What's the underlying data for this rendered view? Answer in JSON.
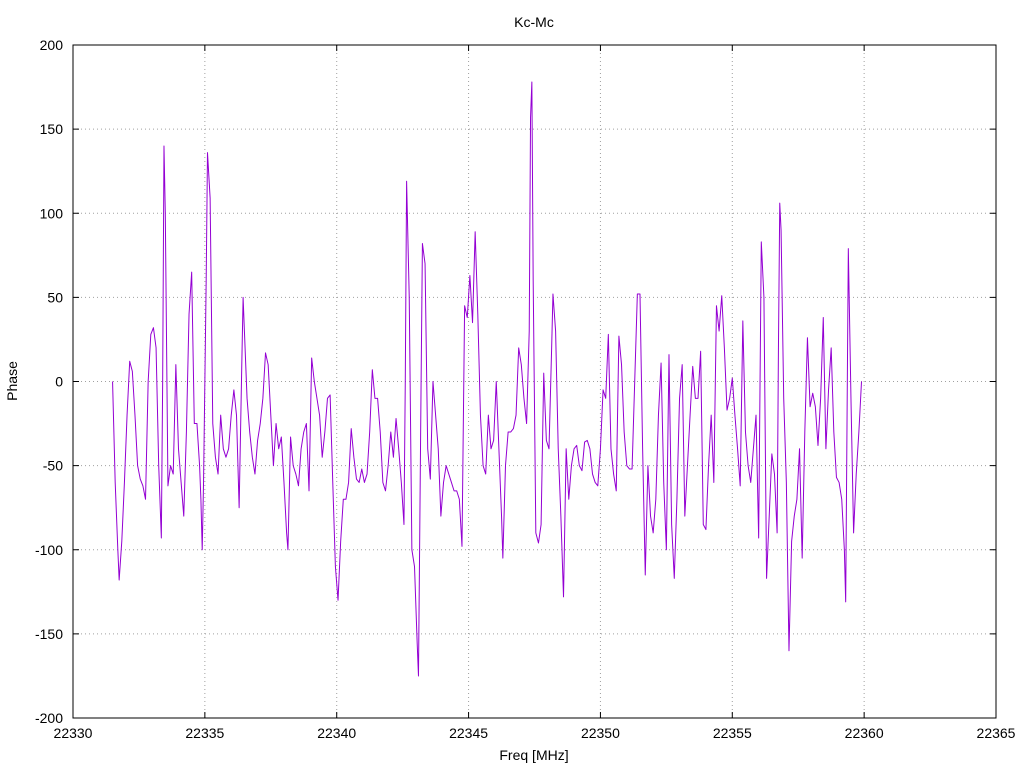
{
  "chart_data": {
    "type": "line",
    "title": "Kc-Mc",
    "xlabel": "Freq [MHz]",
    "ylabel": "Phase",
    "xlim": [
      22330,
      22365
    ],
    "ylim": [
      -200,
      200
    ],
    "x_ticks": [
      "22330",
      "22335",
      "22340",
      "22345",
      "22350",
      "22355",
      "22360",
      "22365"
    ],
    "y_ticks": [
      "200",
      "150",
      "100",
      "50",
      "0",
      "-50",
      "-100",
      "-150",
      "-200"
    ],
    "grid": true,
    "line_color": "#9400d3",
    "series": [
      {
        "values": [
          [
            22331.5,
            0
          ],
          [
            22331.6,
            -60
          ],
          [
            22331.7,
            -100
          ],
          [
            22331.75,
            -118
          ],
          [
            22331.85,
            -95
          ],
          [
            22331.95,
            -60
          ],
          [
            22332.05,
            -20
          ],
          [
            22332.15,
            12
          ],
          [
            22332.25,
            6
          ],
          [
            22332.35,
            -20
          ],
          [
            22332.45,
            -50
          ],
          [
            22332.55,
            -58
          ],
          [
            22332.65,
            -62
          ],
          [
            22332.75,
            -70
          ],
          [
            22332.85,
            0
          ],
          [
            22332.95,
            28
          ],
          [
            22333.05,
            32
          ],
          [
            22333.15,
            20
          ],
          [
            22333.25,
            -50
          ],
          [
            22333.35,
            -93
          ],
          [
            22333.4,
            0
          ],
          [
            22333.45,
            140
          ],
          [
            22333.5,
            100
          ],
          [
            22333.6,
            -62
          ],
          [
            22333.7,
            -50
          ],
          [
            22333.8,
            -55
          ],
          [
            22333.9,
            10
          ],
          [
            22334.0,
            -40
          ],
          [
            22334.1,
            -60
          ],
          [
            22334.2,
            -80
          ],
          [
            22334.3,
            -30
          ],
          [
            22334.4,
            40
          ],
          [
            22334.5,
            65
          ],
          [
            22334.6,
            -25
          ],
          [
            22334.7,
            -25
          ],
          [
            22334.8,
            -50
          ],
          [
            22334.85,
            -70
          ],
          [
            22334.9,
            -100
          ],
          [
            22334.95,
            -60
          ],
          [
            22335.05,
            60
          ],
          [
            22335.1,
            136
          ],
          [
            22335.2,
            109
          ],
          [
            22335.3,
            -25
          ],
          [
            22335.4,
            -45
          ],
          [
            22335.5,
            -55
          ],
          [
            22335.6,
            -20
          ],
          [
            22335.7,
            -40
          ],
          [
            22335.8,
            -45
          ],
          [
            22335.9,
            -40
          ],
          [
            22336.0,
            -20
          ],
          [
            22336.1,
            -5
          ],
          [
            22336.2,
            -20
          ],
          [
            22336.3,
            -75
          ],
          [
            22336.4,
            10
          ],
          [
            22336.45,
            50
          ],
          [
            22336.5,
            30
          ],
          [
            22336.6,
            -10
          ],
          [
            22336.7,
            -30
          ],
          [
            22336.8,
            -45
          ],
          [
            22336.9,
            -55
          ],
          [
            22337.0,
            -35
          ],
          [
            22337.1,
            -25
          ],
          [
            22337.2,
            -10
          ],
          [
            22337.3,
            17
          ],
          [
            22337.4,
            10
          ],
          [
            22337.5,
            -20
          ],
          [
            22337.6,
            -50
          ],
          [
            22337.7,
            -25
          ],
          [
            22337.8,
            -40
          ],
          [
            22337.9,
            -33
          ],
          [
            22338.0,
            -60
          ],
          [
            22338.1,
            -90
          ],
          [
            22338.15,
            -100
          ],
          [
            22338.25,
            -33
          ],
          [
            22338.35,
            -50
          ],
          [
            22338.45,
            -55
          ],
          [
            22338.55,
            -62
          ],
          [
            22338.65,
            -40
          ],
          [
            22338.75,
            -30
          ],
          [
            22338.85,
            -25
          ],
          [
            22338.95,
            -65
          ],
          [
            22339.05,
            14
          ],
          [
            22339.15,
            0
          ],
          [
            22339.25,
            -10
          ],
          [
            22339.35,
            -20
          ],
          [
            22339.45,
            -45
          ],
          [
            22339.55,
            -30
          ],
          [
            22339.65,
            -10
          ],
          [
            22339.75,
            -8
          ],
          [
            22339.85,
            -60
          ],
          [
            22339.95,
            -110
          ],
          [
            22340.05,
            -130
          ],
          [
            22340.15,
            -95
          ],
          [
            22340.25,
            -70
          ],
          [
            22340.35,
            -70
          ],
          [
            22340.45,
            -60
          ],
          [
            22340.55,
            -28
          ],
          [
            22340.65,
            -45
          ],
          [
            22340.75,
            -58
          ],
          [
            22340.85,
            -60
          ],
          [
            22340.95,
            -52
          ],
          [
            22341.05,
            -60
          ],
          [
            22341.15,
            -55
          ],
          [
            22341.25,
            -30
          ],
          [
            22341.35,
            7
          ],
          [
            22341.45,
            -10
          ],
          [
            22341.55,
            -10
          ],
          [
            22341.65,
            -30
          ],
          [
            22341.75,
            -60
          ],
          [
            22341.85,
            -65
          ],
          [
            22341.95,
            -50
          ],
          [
            22342.05,
            -30
          ],
          [
            22342.15,
            -45
          ],
          [
            22342.25,
            -22
          ],
          [
            22342.35,
            -40
          ],
          [
            22342.45,
            -60
          ],
          [
            22342.55,
            -85
          ],
          [
            22342.6,
            0
          ],
          [
            22342.65,
            119
          ],
          [
            22342.75,
            50
          ],
          [
            22342.85,
            -100
          ],
          [
            22342.95,
            -110
          ],
          [
            22343.05,
            -155
          ],
          [
            22343.1,
            -175
          ],
          [
            22343.2,
            0
          ],
          [
            22343.25,
            82
          ],
          [
            22343.35,
            70
          ],
          [
            22343.45,
            -40
          ],
          [
            22343.55,
            -58
          ],
          [
            22343.65,
            0
          ],
          [
            22343.75,
            -20
          ],
          [
            22343.85,
            -40
          ],
          [
            22343.95,
            -80
          ],
          [
            22344.05,
            -60
          ],
          [
            22344.15,
            -50
          ],
          [
            22344.25,
            -55
          ],
          [
            22344.35,
            -60
          ],
          [
            22344.45,
            -65
          ],
          [
            22344.55,
            -65
          ],
          [
            22344.65,
            -70
          ],
          [
            22344.75,
            -98
          ],
          [
            22344.85,
            45
          ],
          [
            22344.95,
            38
          ],
          [
            22345.05,
            63
          ],
          [
            22345.15,
            35
          ],
          [
            22345.25,
            89
          ],
          [
            22345.35,
            40
          ],
          [
            22345.45,
            -20
          ],
          [
            22345.55,
            -50
          ],
          [
            22345.65,
            -55
          ],
          [
            22345.75,
            -20
          ],
          [
            22345.85,
            -40
          ],
          [
            22345.95,
            -35
          ],
          [
            22346.05,
            0
          ],
          [
            22346.15,
            -40
          ],
          [
            22346.25,
            -80
          ],
          [
            22346.3,
            -105
          ],
          [
            22346.4,
            -50
          ],
          [
            22346.5,
            -30
          ],
          [
            22346.6,
            -30
          ],
          [
            22346.7,
            -28
          ],
          [
            22346.8,
            -20
          ],
          [
            22346.9,
            20
          ],
          [
            22347.0,
            10
          ],
          [
            22347.1,
            -10
          ],
          [
            22347.2,
            -25
          ],
          [
            22347.3,
            30
          ],
          [
            22347.35,
            157
          ],
          [
            22347.4,
            178
          ],
          [
            22347.45,
            60
          ],
          [
            22347.55,
            -90
          ],
          [
            22347.65,
            -96
          ],
          [
            22347.75,
            -85
          ],
          [
            22347.85,
            5
          ],
          [
            22347.95,
            -35
          ],
          [
            22348.05,
            -40
          ],
          [
            22348.15,
            20
          ],
          [
            22348.2,
            52
          ],
          [
            22348.3,
            30
          ],
          [
            22348.4,
            -40
          ],
          [
            22348.5,
            -80
          ],
          [
            22348.6,
            -128
          ],
          [
            22348.7,
            -40
          ],
          [
            22348.8,
            -70
          ],
          [
            22348.9,
            -50
          ],
          [
            22349.0,
            -40
          ],
          [
            22349.1,
            -38
          ],
          [
            22349.2,
            -50
          ],
          [
            22349.3,
            -53
          ],
          [
            22349.4,
            -36
          ],
          [
            22349.5,
            -35
          ],
          [
            22349.6,
            -40
          ],
          [
            22349.7,
            -55
          ],
          [
            22349.8,
            -60
          ],
          [
            22349.9,
            -62
          ],
          [
            22350.0,
            -40
          ],
          [
            22350.1,
            -5
          ],
          [
            22350.2,
            -10
          ],
          [
            22350.3,
            28
          ],
          [
            22350.4,
            -40
          ],
          [
            22350.5,
            -55
          ],
          [
            22350.6,
            -65
          ],
          [
            22350.7,
            27
          ],
          [
            22350.8,
            10
          ],
          [
            22350.9,
            -30
          ],
          [
            22351.0,
            -50
          ],
          [
            22351.1,
            -52
          ],
          [
            22351.2,
            -52
          ],
          [
            22351.3,
            0
          ],
          [
            22351.4,
            52
          ],
          [
            22351.5,
            52
          ],
          [
            22351.6,
            -40
          ],
          [
            22351.7,
            -115
          ],
          [
            22351.8,
            -50
          ],
          [
            22351.9,
            -80
          ],
          [
            22352.0,
            -90
          ],
          [
            22352.1,
            -70
          ],
          [
            22352.2,
            -20
          ],
          [
            22352.3,
            11
          ],
          [
            22352.4,
            -60
          ],
          [
            22352.5,
            -100
          ],
          [
            22352.6,
            16
          ],
          [
            22352.7,
            -85
          ],
          [
            22352.8,
            -117
          ],
          [
            22352.9,
            -70
          ],
          [
            22353.0,
            -10
          ],
          [
            22353.1,
            10
          ],
          [
            22353.2,
            -80
          ],
          [
            22353.3,
            -50
          ],
          [
            22353.4,
            -20
          ],
          [
            22353.5,
            9
          ],
          [
            22353.6,
            -10
          ],
          [
            22353.7,
            -10
          ],
          [
            22353.8,
            18
          ],
          [
            22353.9,
            -85
          ],
          [
            22354.0,
            -88
          ],
          [
            22354.1,
            -50
          ],
          [
            22354.2,
            -20
          ],
          [
            22354.3,
            -60
          ],
          [
            22354.4,
            45
          ],
          [
            22354.5,
            30
          ],
          [
            22354.6,
            51
          ],
          [
            22354.7,
            20
          ],
          [
            22354.8,
            -17
          ],
          [
            22354.9,
            -10
          ],
          [
            22355.0,
            2
          ],
          [
            22355.1,
            -20
          ],
          [
            22355.2,
            -40
          ],
          [
            22355.3,
            -62
          ],
          [
            22355.4,
            36
          ],
          [
            22355.5,
            -30
          ],
          [
            22355.6,
            -50
          ],
          [
            22355.7,
            -60
          ],
          [
            22355.8,
            -40
          ],
          [
            22355.9,
            -20
          ],
          [
            22356.0,
            -93
          ],
          [
            22356.1,
            83
          ],
          [
            22356.2,
            50
          ],
          [
            22356.3,
            -117
          ],
          [
            22356.4,
            -80
          ],
          [
            22356.5,
            -43
          ],
          [
            22356.6,
            -55
          ],
          [
            22356.7,
            -90
          ],
          [
            22356.75,
            20
          ],
          [
            22356.8,
            106
          ],
          [
            22356.85,
            90
          ],
          [
            22356.95,
            -10
          ],
          [
            22357.05,
            -60
          ],
          [
            22357.15,
            -160
          ],
          [
            22357.25,
            -95
          ],
          [
            22357.35,
            -80
          ],
          [
            22357.45,
            -70
          ],
          [
            22357.55,
            -40
          ],
          [
            22357.65,
            -105
          ],
          [
            22357.75,
            -30
          ],
          [
            22357.85,
            26
          ],
          [
            22357.95,
            -15
          ],
          [
            22358.05,
            -7
          ],
          [
            22358.15,
            -15
          ],
          [
            22358.25,
            -38
          ],
          [
            22358.35,
            -10
          ],
          [
            22358.45,
            38
          ],
          [
            22358.55,
            -40
          ],
          [
            22358.65,
            -5
          ],
          [
            22358.75,
            20
          ],
          [
            22358.85,
            -30
          ],
          [
            22358.95,
            -57
          ],
          [
            22359.05,
            -60
          ],
          [
            22359.15,
            -70
          ],
          [
            22359.25,
            -100
          ],
          [
            22359.3,
            -131
          ],
          [
            22359.4,
            79
          ],
          [
            22359.5,
            -10
          ],
          [
            22359.6,
            -90
          ],
          [
            22359.7,
            -55
          ],
          [
            22359.8,
            -30
          ],
          [
            22359.9,
            0
          ]
        ]
      }
    ]
  }
}
